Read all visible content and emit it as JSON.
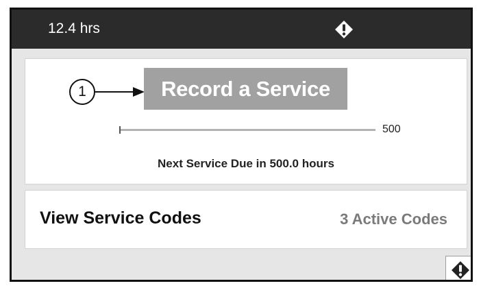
{
  "status_bar": {
    "hours": "12.4 hrs",
    "alert_icon": "alert-diamond-icon"
  },
  "service": {
    "callout_number": "1",
    "record_button_label": "Record a Service",
    "progress": {
      "current_hours": 0,
      "max_hours": 500,
      "max_label": "500"
    },
    "next_service_text": "Next Service Due in 500.0 hours"
  },
  "codes": {
    "title": "View Service Codes",
    "active_count_text": "3 Active Codes"
  },
  "footer": {
    "alert_button_icon": "alert-diamond-icon"
  },
  "colors": {
    "topbar": "#2b2b2b",
    "button_gray": "#a1a1a1",
    "background": "#e6e6e6"
  }
}
